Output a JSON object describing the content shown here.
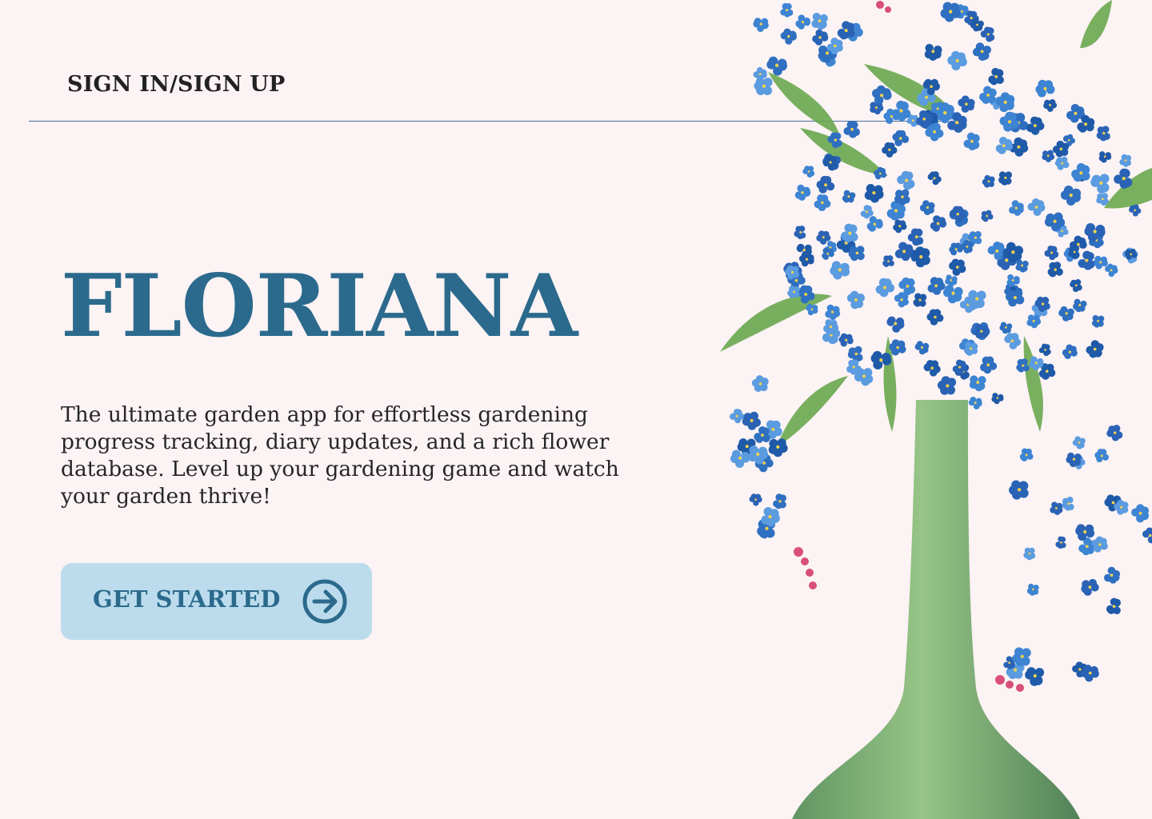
{
  "header": {
    "signin_label": "SIGN IN/SIGN UP"
  },
  "hero": {
    "title": "FLORIANA",
    "tagline": "The ultimate garden app for effortless gardening progress tracking, diary updates, and a rich flower database. Level up your gardening game and watch your garden thrive!",
    "cta_label": "GET STARTED",
    "cta_icon": "arrow-right-circle-icon"
  },
  "colors": {
    "background": "#fcf3f4",
    "accent": "#2b6a8c",
    "button_bg": "#bcdced",
    "text": "#262626"
  }
}
